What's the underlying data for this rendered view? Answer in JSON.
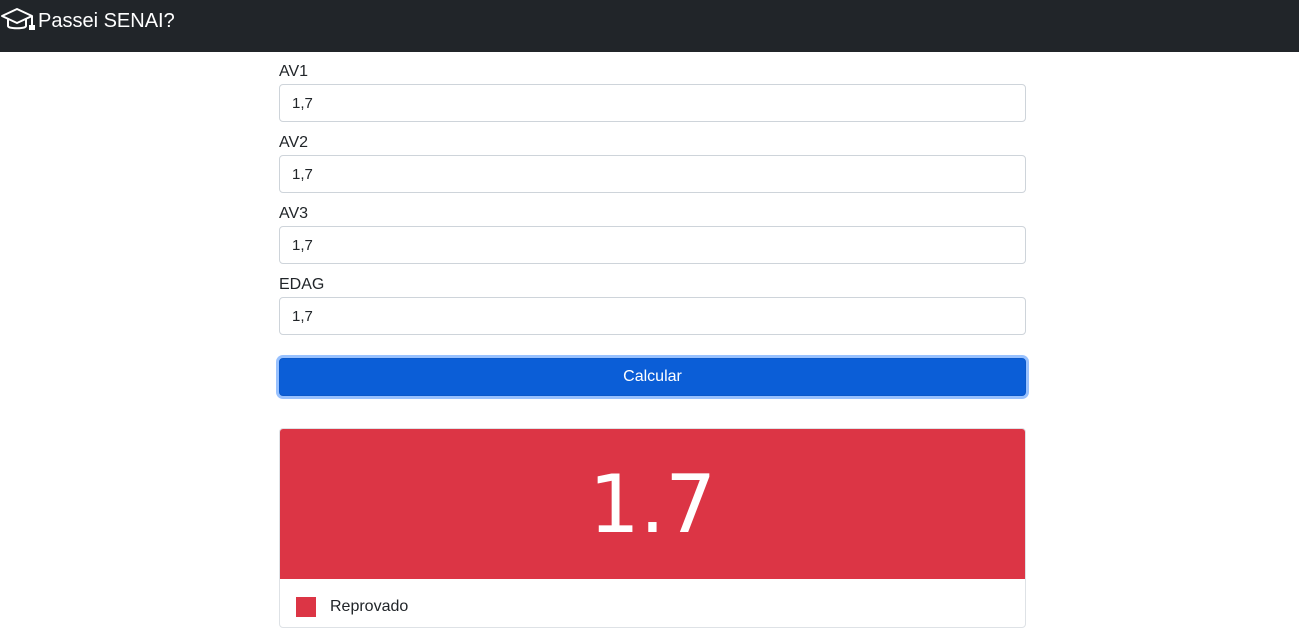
{
  "navbar": {
    "brand_icon": "graduation-cap-icon",
    "brand_text": "Passei SENAI?"
  },
  "form": {
    "fields": [
      {
        "label": "AV1",
        "value": "1,7"
      },
      {
        "label": "AV2",
        "value": "1,7"
      },
      {
        "label": "AV3",
        "value": "1,7"
      },
      {
        "label": "EDAG",
        "value": "1,7"
      }
    ],
    "submit_label": "Calcular"
  },
  "result": {
    "score": "1.7",
    "status_label": "Reprovado",
    "status_color": "#dc3545"
  },
  "colors": {
    "navbar_bg": "#212529",
    "primary": "#0b5ed7",
    "danger": "#dc3545"
  }
}
